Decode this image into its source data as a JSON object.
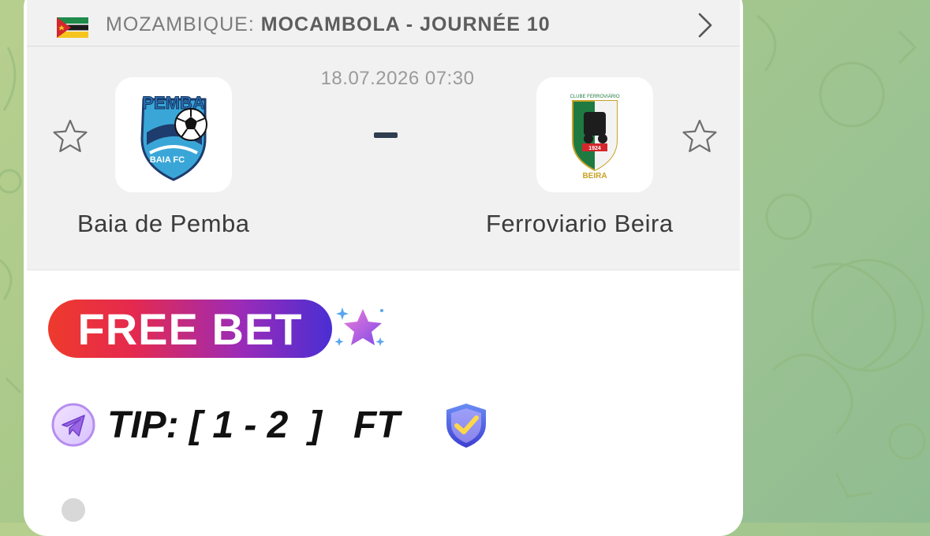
{
  "league": {
    "country": "MOZAMBIQUE:",
    "competition": "MOCAMBOLA - JOURNÉE 10",
    "flag_icon": "mozambique-flag-icon"
  },
  "match": {
    "datetime": "18.07.2026 07:30",
    "score_separator": "-",
    "home_team": {
      "name": "Baia de Pemba",
      "logo_text_top": "PEMBA",
      "logo_text_bottom": "BAIA FC"
    },
    "away_team": {
      "name": "Ferroviario Beira",
      "logo_text_top": "CLUBE FERROVIÁRIO",
      "logo_text_bottom": "BEIRA",
      "logo_year": "1924"
    }
  },
  "promo": {
    "badge_label": "FREE BET",
    "tip_text": "TIP: [ 1 - 2  ]   FT"
  },
  "colors": {
    "badge_start": "#ee3a2c",
    "badge_end": "#4a2ed3",
    "background": "#a9c98a"
  }
}
